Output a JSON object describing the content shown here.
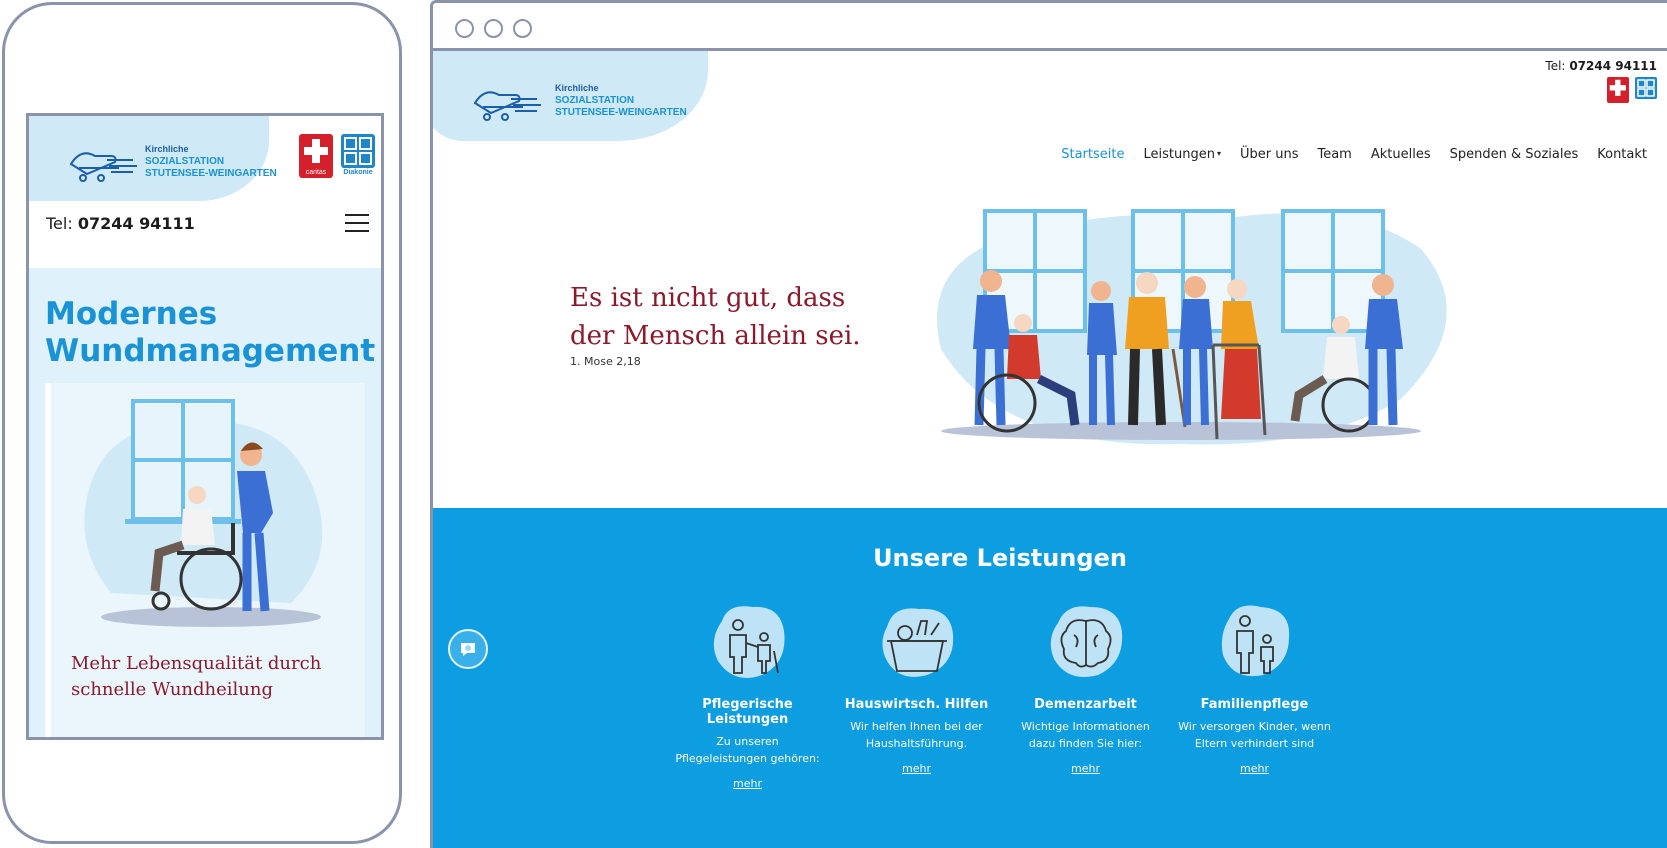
{
  "colors": {
    "brand_blue": "#1a93d6",
    "services_bg": "#0d9ee2",
    "light_blue": "#cfe9f6",
    "quote_red": "#8b1a2b",
    "frame_gray": "#8b93ab"
  },
  "logo": {
    "line1": "Kirchliche",
    "line2": "SOZIALSTATION",
    "line3": "STUTENSEE-WEINGARTEN"
  },
  "badges": {
    "caritas": "caritas",
    "diakonie": "Diakonie"
  },
  "mobile": {
    "phone_label": "Tel:",
    "phone_number": "07244 94111",
    "hero_title": "Modernes Wundmanagement",
    "hero_subtitle": "Mehr Lebensqualität durch schnelle Wundheilung"
  },
  "desktop": {
    "phone_label": "Tel:",
    "phone_number": "07244 94111",
    "nav": [
      {
        "label": "Startseite",
        "active": true
      },
      {
        "label": "Leistungen",
        "dropdown": true
      },
      {
        "label": "Über uns"
      },
      {
        "label": "Team"
      },
      {
        "label": "Aktuelles"
      },
      {
        "label": "Spenden & Soziales"
      },
      {
        "label": "Kontakt"
      }
    ],
    "quote": "Es ist nicht gut, dass der Mensch allein sei.",
    "quote_source": "1. Mose 2,18",
    "services_title": "Unsere Leistungen",
    "services": [
      {
        "name": "Pflegerische Leistungen",
        "desc": "Zu unseren Pflegeleistungen gehören:",
        "more": "mehr",
        "icon": "caregiver-icon"
      },
      {
        "name": "Hauswirtsch. Hilfen",
        "desc": "Wir helfen Ihnen bei der Haushaltsführung.",
        "more": "mehr",
        "icon": "basket-icon"
      },
      {
        "name": "Demenzarbeit",
        "desc": "Wichtige Informationen dazu finden Sie hier:",
        "more": "mehr",
        "icon": "brain-icon"
      },
      {
        "name": "Familienpflege",
        "desc": "Wir versorgen Kinder, wenn Eltern verhindert sind",
        "more": "mehr",
        "icon": "family-icon"
      }
    ]
  }
}
